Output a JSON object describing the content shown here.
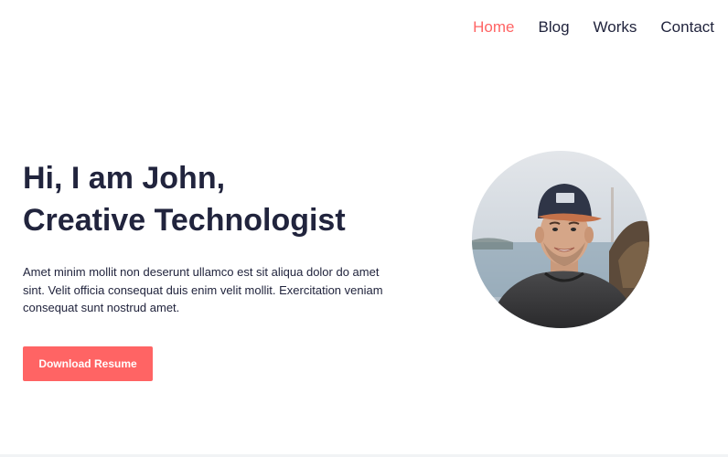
{
  "nav": {
    "items": [
      {
        "label": "Home",
        "active": true
      },
      {
        "label": "Blog",
        "active": false
      },
      {
        "label": "Works",
        "active": false
      },
      {
        "label": "Contact",
        "active": false
      }
    ]
  },
  "hero": {
    "title_line1": "Hi, I am John,",
    "title_line2": "Creative Technologist",
    "description": "Amet minim mollit non deserunt ullamco est sit aliqua dolor do amet sint. Velit officia consequat duis enim velit mollit. Exercitation veniam consequat sunt nostrud amet.",
    "button_label": "Download Resume"
  },
  "avatar": {
    "icon": "profile-photo"
  },
  "colors": {
    "accent": "#ff6464",
    "text": "#21243d",
    "background": "#ffffff"
  }
}
